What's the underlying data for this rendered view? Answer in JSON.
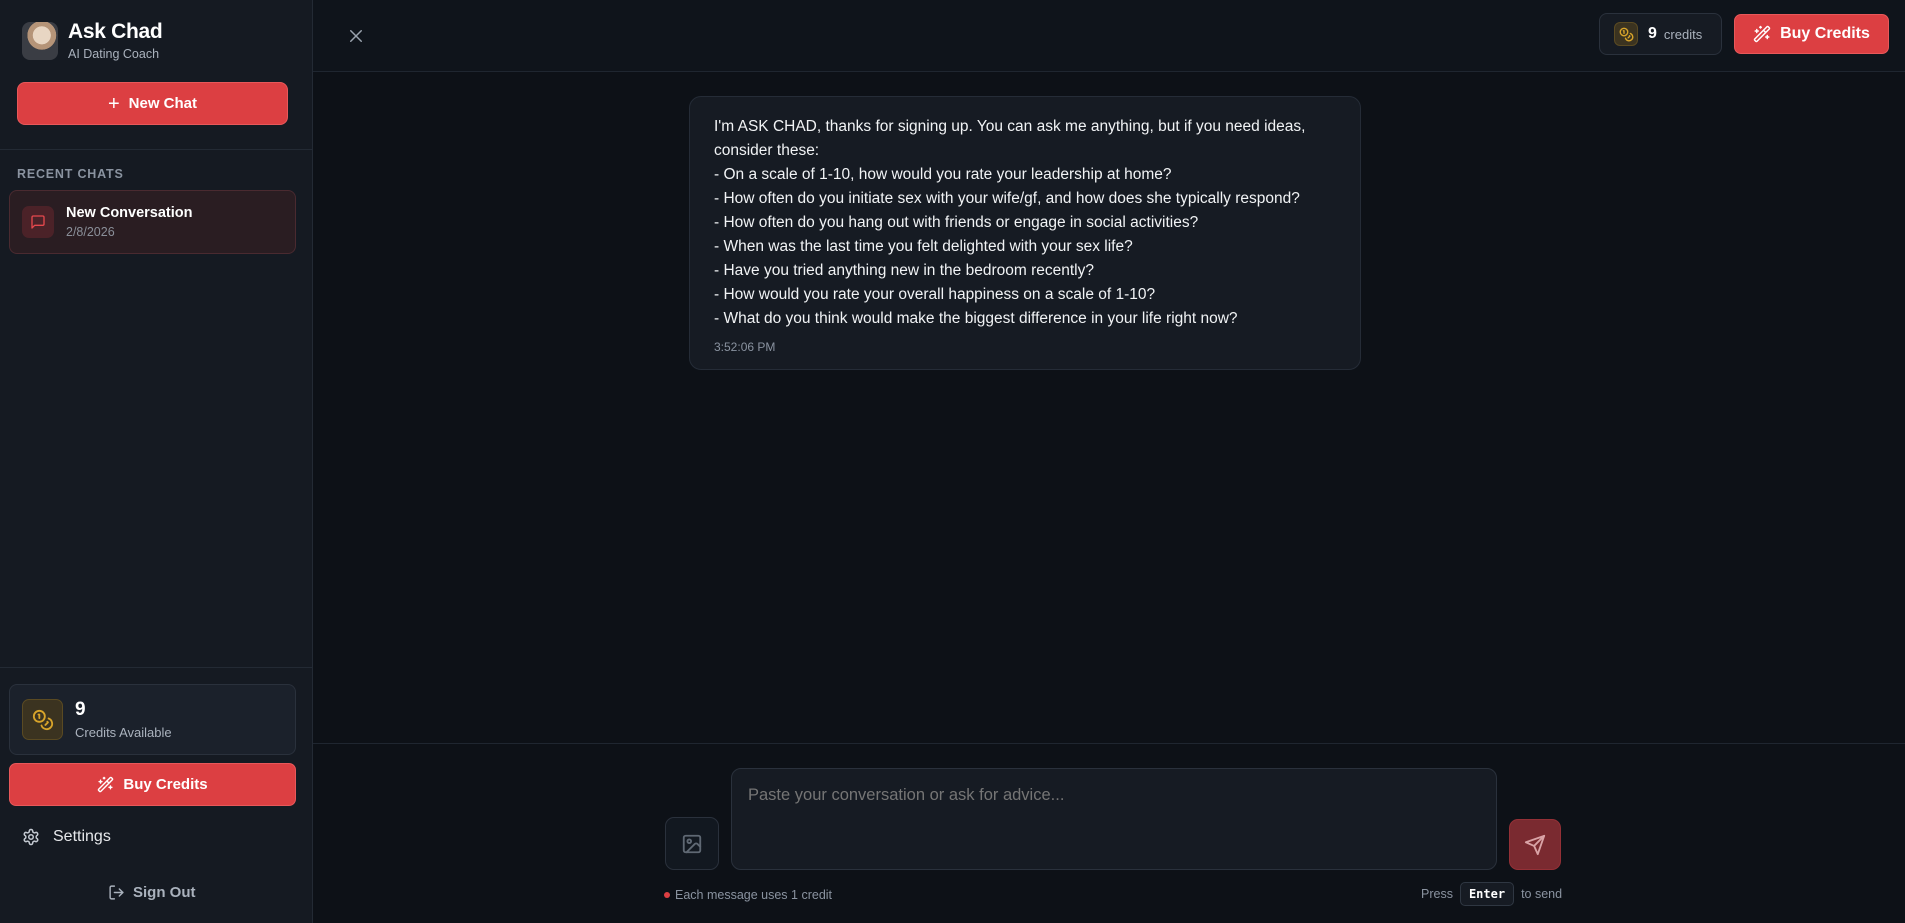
{
  "app": {
    "title": "Ask Chad",
    "subtitle": "AI Dating Coach"
  },
  "sidebar": {
    "new_chat_label": "New Chat",
    "recent_label": "RECENT CHATS",
    "chats": [
      {
        "title": "New Conversation",
        "date": "2/8/2026"
      }
    ],
    "credits": {
      "count": "9",
      "label": "Credits Available"
    },
    "buy_label": "Buy Credits",
    "settings_label": "Settings",
    "signout_label": "Sign Out"
  },
  "header": {
    "credits_count": "9",
    "credits_label": "credits",
    "buy_label": "Buy Credits"
  },
  "message": {
    "lines": [
      "I'm ASK CHAD, thanks for signing up. You can ask me anything, but if you need ideas,",
      "consider these:",
      "- On a scale of 1-10, how would you rate your leadership at home?",
      "- How often do you initiate sex with your wife/gf, and how does she typically respond?",
      "- How often do you hang out with friends or engage in social activities?",
      "- When was the last time you felt delighted with your sex life?",
      "- Have you tried anything new in the bedroom recently?",
      "- How would you rate your overall happiness on a scale of 1-10?",
      "- What do you think would make the biggest difference in your life right now?"
    ],
    "time": "3:52:06 PM"
  },
  "composer": {
    "placeholder": "Paste your conversation or ask for advice...",
    "value": "",
    "cost_note": "Each message uses 1 credit",
    "press_label": "Press",
    "key_label": "Enter",
    "send_hint": "to send"
  },
  "colors": {
    "accent": "#dc3f42",
    "background": "#0d1117",
    "sidebar": "#151a22",
    "coin": "#d8a42a"
  }
}
